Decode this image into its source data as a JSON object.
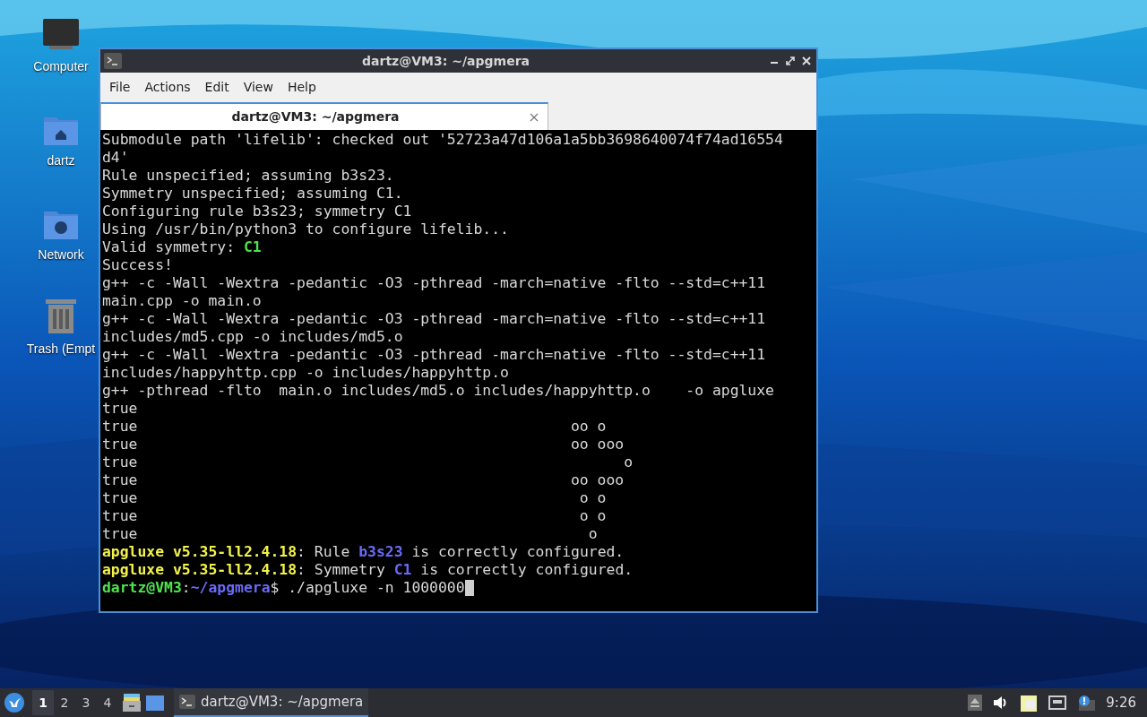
{
  "desktop_icons": [
    {
      "label": "Computer",
      "kind": "computer"
    },
    {
      "label": "dartz",
      "kind": "home"
    },
    {
      "label": "Network",
      "kind": "network"
    },
    {
      "label": "Trash (Empt",
      "kind": "trash"
    }
  ],
  "window": {
    "title": "dartz@VM3: ~/apgmera",
    "menu": [
      "File",
      "Actions",
      "Edit",
      "View",
      "Help"
    ],
    "tabs": [
      {
        "label": "dartz@VM3: ~/apgmera",
        "selected": true
      }
    ],
    "terminal": {
      "lines": [
        [
          {
            "text": "Submodule path 'lifelib': checked out '52723a47d106a1a5bb3698640074f74ad16554"
          }
        ],
        [
          {
            "text": "d4'"
          }
        ],
        [
          {
            "text": "Rule unspecified; assuming b3s23."
          }
        ],
        [
          {
            "text": "Symmetry unspecified; assuming C1."
          }
        ],
        [
          {
            "text": "Configuring rule b3s23; symmetry C1"
          }
        ],
        [
          {
            "text": "Using /usr/bin/python3 to configure lifelib..."
          }
        ],
        [
          {
            "text": "Valid symmetry: "
          },
          {
            "text": "C1",
            "color": "#4ee44e"
          }
        ],
        [
          {
            "text": "Success!"
          }
        ],
        [
          {
            "text": "g++ -c -Wall -Wextra -pedantic -O3 -pthread -march=native -flto --std=c++11"
          }
        ],
        [
          {
            "text": "main.cpp -o main.o"
          }
        ],
        [
          {
            "text": "g++ -c -Wall -Wextra -pedantic -O3 -pthread -march=native -flto --std=c++11"
          }
        ],
        [
          {
            "text": "includes/md5.cpp -o includes/md5.o"
          }
        ],
        [
          {
            "text": "g++ -c -Wall -Wextra -pedantic -O3 -pthread -march=native -flto --std=c++11"
          }
        ],
        [
          {
            "text": "includes/happyhttp.cpp -o includes/happyhttp.o"
          }
        ],
        [
          {
            "text": "g++ -pthread -flto  main.o includes/md5.o includes/happyhttp.o    -o apgluxe"
          }
        ],
        [
          {
            "text": "true"
          }
        ],
        [
          {
            "text": "true                                                 oo o"
          }
        ],
        [
          {
            "text": "true                                                 oo ooo"
          }
        ],
        [
          {
            "text": "true                                                       o"
          }
        ],
        [
          {
            "text": "true                                                 oo ooo"
          }
        ],
        [
          {
            "text": "true                                                  o o"
          }
        ],
        [
          {
            "text": "true                                                  o o"
          }
        ],
        [
          {
            "text": "true                                                   o"
          }
        ],
        [
          {
            "text": "apgluxe v5.35-ll2.4.18",
            "color": "#f2f24a"
          },
          {
            "text": ": Rule "
          },
          {
            "text": "b3s23",
            "color": "#6a6af8"
          },
          {
            "text": " is correctly configured."
          }
        ],
        [
          {
            "text": "apgluxe v5.35-ll2.4.18",
            "color": "#f2f24a"
          },
          {
            "text": ": Symmetry "
          },
          {
            "text": "C1",
            "color": "#6a6af8"
          },
          {
            "text": " is correctly configured."
          }
        ],
        [
          {
            "text": "dartz@VM3",
            "color": "#4ee44e"
          },
          {
            "text": ":"
          },
          {
            "text": "~/apgmera",
            "color": "#6a6af8"
          },
          {
            "text": "$ ./apgluxe -n 1000000"
          }
        ]
      ]
    }
  },
  "taskbar": {
    "workspaces": [
      {
        "label": "1",
        "selected": true
      },
      {
        "label": "2",
        "selected": false
      },
      {
        "label": "3",
        "selected": false
      },
      {
        "label": "4",
        "selected": false
      }
    ],
    "tasks": [
      {
        "label": "dartz@VM3: ~/apgmera",
        "selected": true
      }
    ],
    "clock": "9:26"
  }
}
